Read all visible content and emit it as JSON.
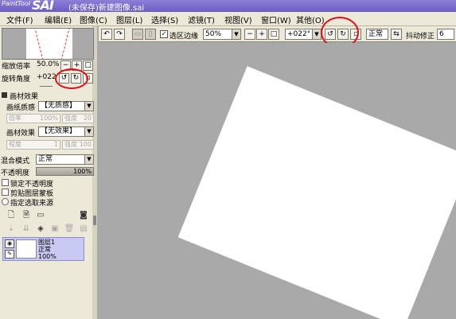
{
  "titlebar": {
    "logo_text": "PaintTool",
    "logo_sai": "SAI",
    "title": "(未保存)新建图像.sai"
  },
  "menu": [
    "文件(F)",
    "编辑(E)",
    "图像(C)",
    "图层(L)",
    "选择(S)",
    "滤镜(T)",
    "视图(V)",
    "窗口(W)",
    "其他(O)"
  ],
  "navigator": {
    "zoom_label": "缩放倍率",
    "zoom_value": "50.0%",
    "rotate_label": "旋转角度",
    "rotate_value": "+022"
  },
  "paper_effects": {
    "section_label": "画材效果",
    "texture_label": "画纸质感",
    "texture_value": "【无质感】",
    "rate_label": "倍率",
    "rate_value": "100%",
    "intensity_label": "强度",
    "intensity_value": "20",
    "effect_label": "画材效果",
    "effect_value": "【无效果】",
    "width_label": "程度",
    "width_value": "1",
    "strength_label": "强度",
    "strength_value": "100"
  },
  "blending": {
    "mode_label": "混合模式",
    "mode_value": "正常",
    "opacity_label": "不透明度",
    "opacity_value": "100%"
  },
  "options": {
    "lock_opacity": "锁定不透明度",
    "clip_group": "剪贴图层蒙板",
    "selection_source": "指定选取来源"
  },
  "layer": {
    "name": "图层1",
    "mode": "正常",
    "opacity": "100%"
  },
  "toolbar": {
    "selection_edge_label": "选区边缘",
    "zoom_value": "50%",
    "zoom_minus": "−",
    "zoom_plus": "+",
    "rotate_value": "+022°",
    "blend_value": "正常",
    "stabilizer_label": "抖动修正",
    "stabilizer_value": "6"
  },
  "colors": {
    "annotation": "#e0101a",
    "canvas_bg": "#a9a9a9",
    "layer_selected": "#c9c9f4"
  },
  "icons": [
    "new-layer-icon",
    "new-linework-icon",
    "new-folder-icon",
    "mask-icon",
    "eye-icon",
    "pen-icon",
    "rotate-ccw-icon",
    "rotate-cw-icon",
    "reset-rotation-icon",
    "flip-icon"
  ]
}
